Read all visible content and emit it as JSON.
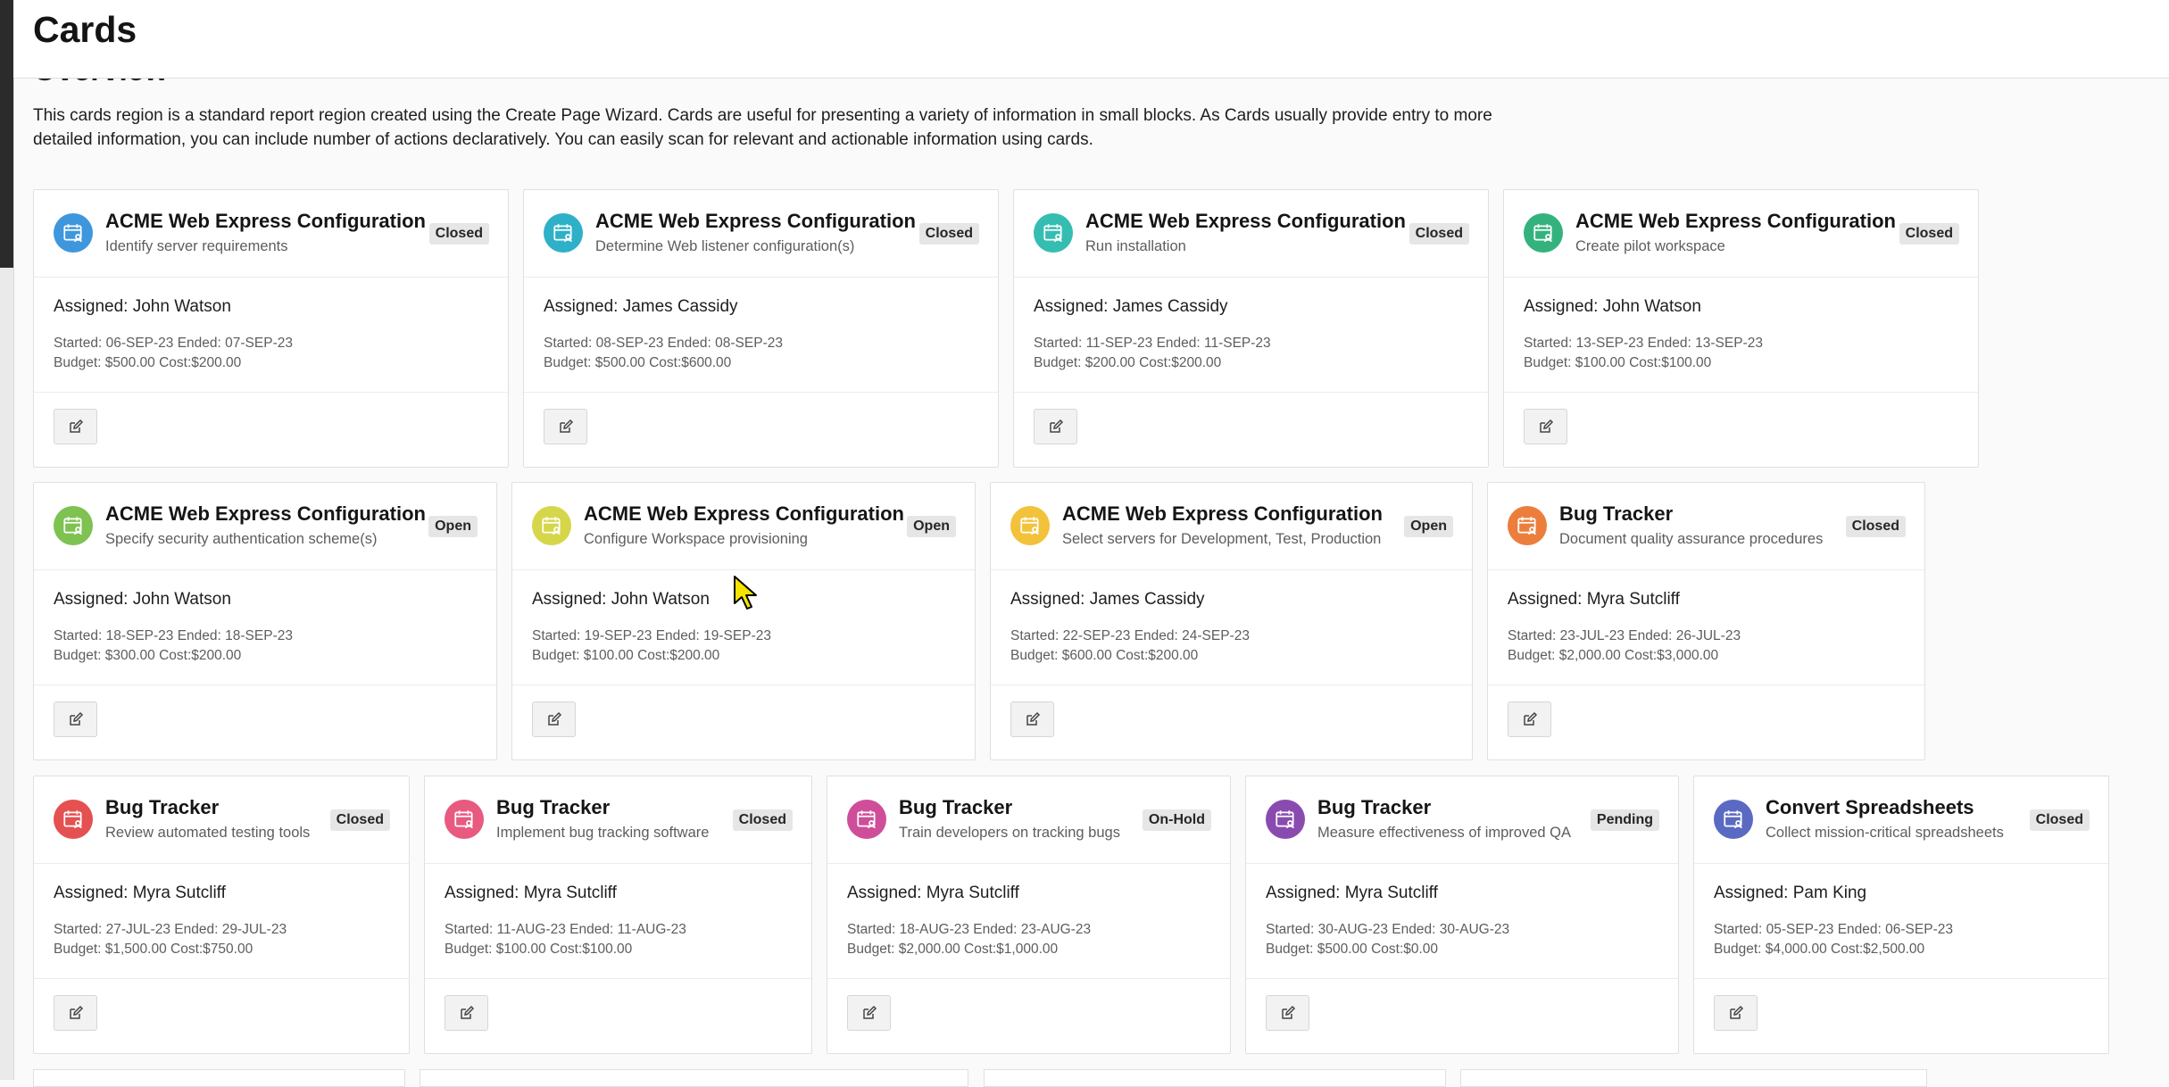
{
  "page": {
    "title": "Cards",
    "section_heading": "Overview",
    "description": "This cards region is a standard report region created using the Create Page Wizard. Cards are useful for presenting a variety of information in small blocks. As Cards usually provide entry to more detailed information, you can include number of actions declaratively. You can easily scan for relevant and actionable information using cards."
  },
  "icons": {
    "card_icon": "calendar-person-icon",
    "edit_icon": "edit-pencil-icon"
  },
  "cards": [
    {
      "title": "ACME Web Express Configuration",
      "subtitle": "Identify server requirements",
      "status": "Closed",
      "assigned": "Assigned: John Watson",
      "dates": "Started: 06-SEP-23 Ended: 07-SEP-23",
      "budget": "Budget: $500.00 Cost:$200.00",
      "color": "#3e97dc"
    },
    {
      "title": "ACME Web Express Configuration",
      "subtitle": "Determine Web listener configuration(s)",
      "status": "Closed",
      "assigned": "Assigned: James Cassidy",
      "dates": "Started: 08-SEP-23 Ended: 08-SEP-23",
      "budget": "Budget: $500.00 Cost:$600.00",
      "color": "#2fb0c9"
    },
    {
      "title": "ACME Web Express Configuration",
      "subtitle": "Run installation",
      "status": "Closed",
      "assigned": "Assigned: James Cassidy",
      "dates": "Started: 11-SEP-23 Ended: 11-SEP-23",
      "budget": "Budget: $200.00 Cost:$200.00",
      "color": "#35bdb2"
    },
    {
      "title": "ACME Web Express Configuration",
      "subtitle": "Create pilot workspace",
      "status": "Closed",
      "assigned": "Assigned: John Watson",
      "dates": "Started: 13-SEP-23 Ended: 13-SEP-23",
      "budget": "Budget: $100.00 Cost:$100.00",
      "color": "#34b27d"
    },
    {
      "title": "ACME Web Express Configuration",
      "subtitle": "Specify security authentication scheme(s)",
      "status": "Open",
      "assigned": "Assigned: John Watson",
      "dates": "Started: 18-SEP-23 Ended: 18-SEP-23",
      "budget": "Budget: $300.00 Cost:$200.00",
      "color": "#7ec252"
    },
    {
      "title": "ACME Web Express Configuration",
      "subtitle": "Configure Workspace provisioning",
      "status": "Open",
      "assigned": "Assigned: John Watson",
      "dates": "Started: 19-SEP-23 Ended: 19-SEP-23",
      "budget": "Budget: $100.00 Cost:$200.00",
      "color": "#d6d64a"
    },
    {
      "title": "ACME Web Express Configuration",
      "subtitle": "Select servers for Development, Test, Production",
      "status": "Open",
      "assigned": "Assigned: James Cassidy",
      "dates": "Started: 22-SEP-23 Ended: 24-SEP-23",
      "budget": "Budget: $600.00 Cost:$200.00",
      "color": "#f2c23a"
    },
    {
      "title": "Bug Tracker",
      "subtitle": "Document quality assurance procedures",
      "status": "Closed",
      "assigned": "Assigned: Myra Sutcliff",
      "dates": "Started: 23-JUL-23 Ended: 26-JUL-23",
      "budget": "Budget: $2,000.00 Cost:$3,000.00",
      "color": "#ec7e3d"
    },
    {
      "title": "Bug Tracker",
      "subtitle": "Review automated testing tools",
      "status": "Closed",
      "assigned": "Assigned: Myra Sutcliff",
      "dates": "Started: 27-JUL-23 Ended: 29-JUL-23",
      "budget": "Budget: $1,500.00 Cost:$750.00",
      "color": "#e55050"
    },
    {
      "title": "Bug Tracker",
      "subtitle": "Implement bug tracking software",
      "status": "Closed",
      "assigned": "Assigned: Myra Sutcliff",
      "dates": "Started: 11-AUG-23 Ended: 11-AUG-23",
      "budget": "Budget: $100.00 Cost:$100.00",
      "color": "#e85a80"
    },
    {
      "title": "Bug Tracker",
      "subtitle": "Train developers on tracking bugs",
      "status": "On-Hold",
      "assigned": "Assigned: Myra Sutcliff",
      "dates": "Started: 18-AUG-23 Ended: 23-AUG-23",
      "budget": "Budget: $2,000.00 Cost:$1,000.00",
      "color": "#cf4e9a"
    },
    {
      "title": "Bug Tracker",
      "subtitle": "Measure effectiveness of improved QA",
      "status": "Pending",
      "assigned": "Assigned: Myra Sutcliff",
      "dates": "Started: 30-AUG-23 Ended: 30-AUG-23",
      "budget": "Budget: $500.00 Cost:$0.00",
      "color": "#8a4bb0"
    },
    {
      "title": "Convert Spreadsheets",
      "subtitle": "Collect mission-critical spreadsheets",
      "status": "Closed",
      "assigned": "Assigned: Pam King",
      "dates": "Started: 05-SEP-23 Ended: 06-SEP-23",
      "budget": "Budget: $4,000.00 Cost:$2,500.00",
      "color": "#5a6ac2"
    }
  ]
}
